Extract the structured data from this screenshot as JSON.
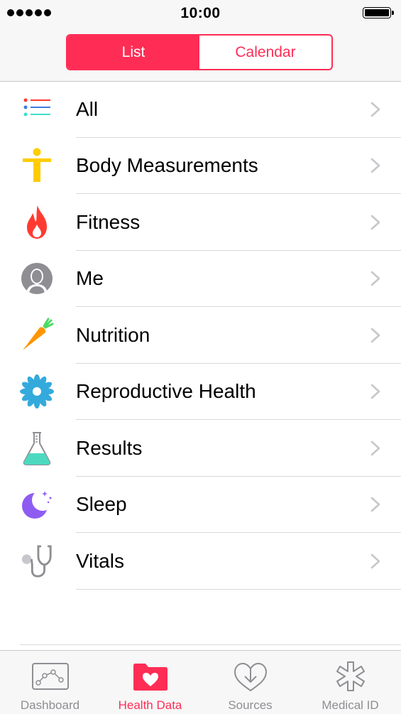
{
  "status_bar": {
    "time": "10:00"
  },
  "segmented": {
    "list_label": "List",
    "calendar_label": "Calendar",
    "selected": "List"
  },
  "categories": [
    {
      "label": "All",
      "icon": "list-icon"
    },
    {
      "label": "Body Measurements",
      "icon": "body-figure-icon"
    },
    {
      "label": "Fitness",
      "icon": "flame-icon"
    },
    {
      "label": "Me",
      "icon": "person-silhouette-icon"
    },
    {
      "label": "Nutrition",
      "icon": "carrot-icon"
    },
    {
      "label": "Reproductive Health",
      "icon": "flower-icon"
    },
    {
      "label": "Results",
      "icon": "flask-icon"
    },
    {
      "label": "Sleep",
      "icon": "moon-icon"
    },
    {
      "label": "Vitals",
      "icon": "stethoscope-icon"
    }
  ],
  "tab_bar": {
    "tabs": [
      {
        "label": "Dashboard",
        "icon": "chart-icon"
      },
      {
        "label": "Health Data",
        "icon": "folder-heart-icon"
      },
      {
        "label": "Sources",
        "icon": "heart-download-icon"
      },
      {
        "label": "Medical ID",
        "icon": "medical-star-icon"
      }
    ],
    "selected": "Health Data"
  },
  "colors": {
    "accent": "#ff2d55",
    "chevron": "#c7c7cc",
    "inactive_tab": "#8e8e93"
  }
}
